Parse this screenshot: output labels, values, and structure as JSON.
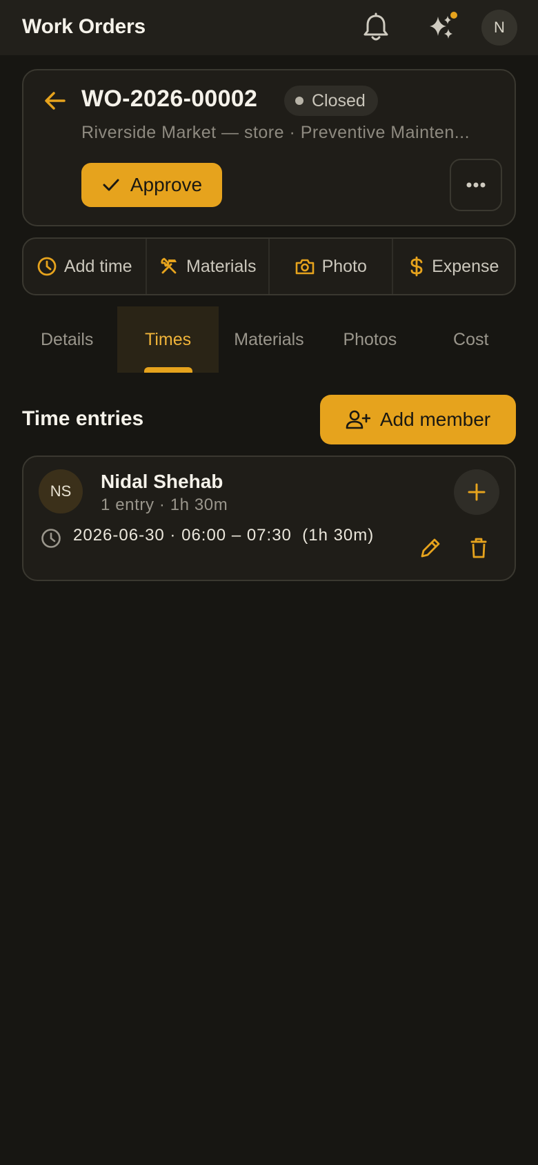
{
  "appbar": {
    "title": "Work Orders",
    "avatar_initial": "N"
  },
  "header": {
    "wo_number": "WO-2026-00002",
    "status": "Closed",
    "subtitle": "Riverside Market — store  ·  Preventive Mainten...",
    "approve_label": "Approve"
  },
  "actions": [
    {
      "label": "Add time",
      "icon": "clock-icon"
    },
    {
      "label": "Materials",
      "icon": "tools-icon"
    },
    {
      "label": "Photo",
      "icon": "camera-icon"
    },
    {
      "label": "Expense",
      "icon": "dollar-icon"
    }
  ],
  "tabs": [
    {
      "label": "Details",
      "active": false
    },
    {
      "label": "Times",
      "active": true
    },
    {
      "label": "Materials",
      "active": false
    },
    {
      "label": "Photos",
      "active": false
    },
    {
      "label": "Cost",
      "active": false
    }
  ],
  "section": {
    "title": "Time entries",
    "add_member_label": "Add member"
  },
  "member": {
    "initials": "NS",
    "name": "Nidal Shehab",
    "summary": "1 entry · 1h 30m",
    "entry": "2026-06-30 · 06:00 – 07:30  (1h 30m)"
  },
  "colors": {
    "accent": "#e6a31d",
    "background": "#171612",
    "surface": "#1f1d18"
  }
}
